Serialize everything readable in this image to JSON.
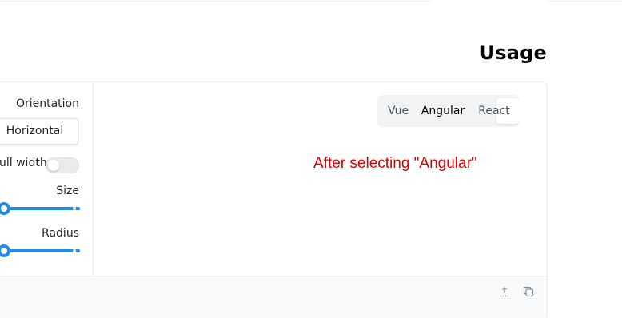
{
  "page": {
    "title": "Usage"
  },
  "controls": {
    "orientation_label": "Orientation",
    "orientation_value": "Horizontal",
    "full_width_label": "ull width",
    "full_width_on": false,
    "size_label": "Size",
    "size_level": 0.2,
    "radius_label": "Radius",
    "radius_level": 0.2
  },
  "preview": {
    "segments": [
      "Vue",
      "Angular",
      "React"
    ],
    "selected_segment": "Angular"
  },
  "annotation": {
    "text": "After selecting \"Angular\""
  },
  "code_toolbar": {
    "icons": [
      "share-icon",
      "copy-icon"
    ]
  },
  "colors": {
    "accent": "#228be6",
    "annotation": "#e00000",
    "border": "#e9ecef"
  }
}
